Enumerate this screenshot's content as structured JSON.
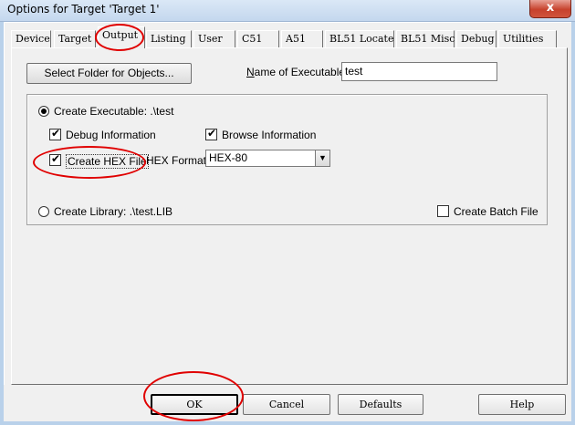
{
  "window": {
    "title": "Options for Target 'Target 1'",
    "close_label": "x"
  },
  "tabs": [
    {
      "label": "Device"
    },
    {
      "label": "Target"
    },
    {
      "label": "Output"
    },
    {
      "label": "Listing"
    },
    {
      "label": "User"
    },
    {
      "label": "C51"
    },
    {
      "label": "A51"
    },
    {
      "label": "BL51 Locate"
    },
    {
      "label": "BL51 Misc"
    },
    {
      "label": "Debug"
    },
    {
      "label": "Utilities"
    }
  ],
  "active_tab": "Output",
  "output": {
    "select_folder_label": "Select Folder for Objects...",
    "name_label": "Name of Executable:",
    "name_value": "test",
    "create_executable_label": "Create Executable:  .\\test",
    "create_executable_selected": true,
    "debug_info_label": "Debug Information",
    "debug_info_checked": true,
    "browse_info_label": "Browse Information",
    "browse_info_checked": true,
    "create_hex_label": "Create HEX File",
    "create_hex_checked": true,
    "hex_format_label": "HEX Format:",
    "hex_format_value": "HEX-80",
    "create_library_label": "Create Library:  .\\test.LIB",
    "create_library_selected": false,
    "create_batch_label": "Create Batch File",
    "create_batch_checked": false
  },
  "buttons": {
    "ok": "OK",
    "cancel": "Cancel",
    "defaults": "Defaults",
    "help": "Help"
  },
  "glyphs": {
    "check": "✔",
    "dropdown_arrow": "▼"
  }
}
